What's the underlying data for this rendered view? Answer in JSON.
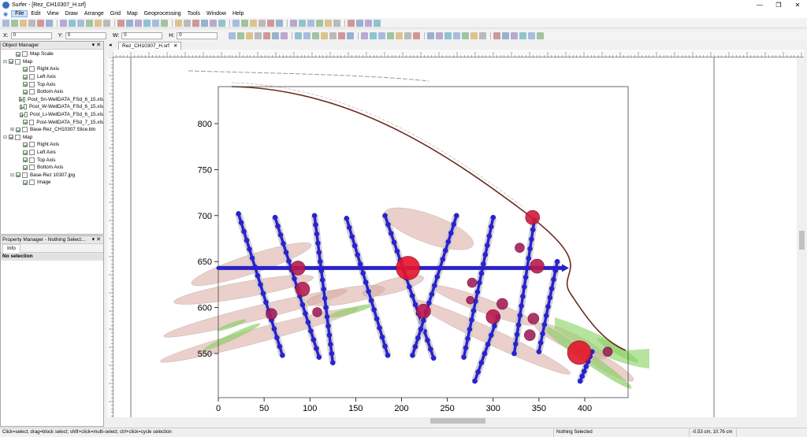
{
  "app": {
    "title": "Surfer - [Rez_CH10307_H.srf]",
    "win_controls": [
      "—",
      "❐",
      "✕"
    ]
  },
  "menu": [
    "File",
    "Edit",
    "View",
    "Draw",
    "Arrange",
    "Grid",
    "Map",
    "Geoprocessing",
    "Tools",
    "Window",
    "Help"
  ],
  "coords": {
    "x_label": "X:",
    "x_value": "0",
    "y_label": "Y:",
    "y_value": "0",
    "w_label": "W:",
    "w_value": "0",
    "h_label": "H:",
    "h_value": "0"
  },
  "object_manager": {
    "title": "Object Manager",
    "items": [
      {
        "label": "Map Scale",
        "level": 1,
        "checked": true,
        "expander": ""
      },
      {
        "label": "Map",
        "level": 0,
        "checked": true,
        "expander": "⊟"
      },
      {
        "label": "Right Axis",
        "level": 2,
        "checked": true,
        "expander": ""
      },
      {
        "label": "Left Axis",
        "level": 2,
        "checked": true,
        "expander": ""
      },
      {
        "label": "Top Axis",
        "level": 2,
        "checked": true,
        "expander": ""
      },
      {
        "label": "Bottom Axis",
        "level": 2,
        "checked": true,
        "expander": ""
      },
      {
        "label": "Post_Sn-WellDATA_FSd_6_15.xls",
        "level": 2,
        "checked": true,
        "expander": ""
      },
      {
        "label": "Post_W-WellDATA_FSd_6_15.xls",
        "level": 2,
        "checked": true,
        "expander": ""
      },
      {
        "label": "Post_Li-WellDATA_FSd_6_15.xls",
        "level": 2,
        "checked": true,
        "expander": ""
      },
      {
        "label": "Post-WellDATA_FSd_7_15.xls",
        "level": 2,
        "checked": true,
        "expander": ""
      },
      {
        "label": "Base-Rez_CH10307 Slice.bln",
        "level": 1,
        "checked": true,
        "expander": "⊞"
      },
      {
        "label": "Map",
        "level": 0,
        "checked": true,
        "expander": "⊟"
      },
      {
        "label": "Right Axis",
        "level": 2,
        "checked": true,
        "expander": ""
      },
      {
        "label": "Left Axis",
        "level": 2,
        "checked": true,
        "expander": ""
      },
      {
        "label": "Top Axis",
        "level": 2,
        "checked": true,
        "expander": ""
      },
      {
        "label": "Bottom Axis",
        "level": 2,
        "checked": true,
        "expander": ""
      },
      {
        "label": "Base-Rez 10307.jpg",
        "level": 1,
        "checked": true,
        "expander": "⊟"
      },
      {
        "label": "Image",
        "level": 2,
        "checked": true,
        "expander": ""
      }
    ]
  },
  "property_manager": {
    "title": "Property Manager - Nothing Select...",
    "tab": "Info",
    "content": "No selection"
  },
  "document_tab": {
    "label": "Rez_CH10307_H.srf",
    "close": "✕"
  },
  "chart_data": {
    "type": "scatter",
    "x_ticks": [
      "0",
      "50",
      "100",
      "150",
      "200",
      "250",
      "300",
      "350",
      "400"
    ],
    "y_ticks": [
      "800",
      "750",
      "700",
      "650",
      "600",
      "550"
    ],
    "xlim": [
      0,
      450
    ],
    "ylim": [
      515,
      840
    ],
    "horizontal_line": {
      "y": 643,
      "x_start": 0,
      "x_stop": 375
    },
    "wells": [
      {
        "x1": 22,
        "y1": 702,
        "x2": 70,
        "y2": 548
      },
      {
        "x1": 62,
        "y1": 698,
        "x2": 110,
        "y2": 546
      },
      {
        "x1": 105,
        "y1": 700,
        "x2": 125,
        "y2": 540
      },
      {
        "x1": 140,
        "y1": 697,
        "x2": 185,
        "y2": 548
      },
      {
        "x1": 182,
        "y1": 700,
        "x2": 235,
        "y2": 545
      },
      {
        "x1": 260,
        "y1": 700,
        "x2": 212,
        "y2": 548
      },
      {
        "x1": 300,
        "y1": 698,
        "x2": 268,
        "y2": 546
      },
      {
        "x1": 305,
        "y1": 590,
        "x2": 280,
        "y2": 520
      },
      {
        "x1": 345,
        "y1": 695,
        "x2": 323,
        "y2": 550
      },
      {
        "x1": 370,
        "y1": 650,
        "x2": 350,
        "y2": 552
      },
      {
        "x1": 408,
        "y1": 552,
        "x2": 395,
        "y2": 520
      }
    ],
    "bubbles": [
      {
        "x": 207,
        "y": 643,
        "r": 15,
        "color": "#e6142a"
      },
      {
        "x": 394,
        "y": 551,
        "r": 15,
        "color": "#e6142a"
      },
      {
        "x": 343,
        "y": 698,
        "r": 9,
        "color": "#d01a3a"
      },
      {
        "x": 87,
        "y": 643,
        "r": 9,
        "color": "#b81a50"
      },
      {
        "x": 92,
        "y": 620,
        "r": 9,
        "color": "#b81a50"
      },
      {
        "x": 224,
        "y": 596,
        "r": 9,
        "color": "#b81a50"
      },
      {
        "x": 300,
        "y": 590,
        "r": 9,
        "color": "#b81a50"
      },
      {
        "x": 348,
        "y": 645,
        "r": 9,
        "color": "#b81a50"
      },
      {
        "x": 58,
        "y": 593,
        "r": 7,
        "color": "#a21f5e"
      },
      {
        "x": 108,
        "y": 595,
        "r": 6,
        "color": "#a21f5e"
      },
      {
        "x": 277,
        "y": 627,
        "r": 6,
        "color": "#a21f5e"
      },
      {
        "x": 310,
        "y": 604,
        "r": 7,
        "color": "#a21f5e"
      },
      {
        "x": 329,
        "y": 665,
        "r": 6,
        "color": "#a21f5e"
      },
      {
        "x": 344,
        "y": 588,
        "r": 7,
        "color": "#a21f5e"
      },
      {
        "x": 340,
        "y": 570,
        "r": 7,
        "color": "#a21f5e"
      },
      {
        "x": 425,
        "y": 552,
        "r": 6,
        "color": "#a21f5e"
      },
      {
        "x": 275,
        "y": 608,
        "r": 5,
        "color": "#a21f5e"
      }
    ]
  },
  "status": {
    "hint": "Click=select; drag=block select; shift+click=multi-select; ctrl+click=cycle selection",
    "selection": "Nothing Selected",
    "cursor": "-0.53 cm, 10.76 cm"
  }
}
